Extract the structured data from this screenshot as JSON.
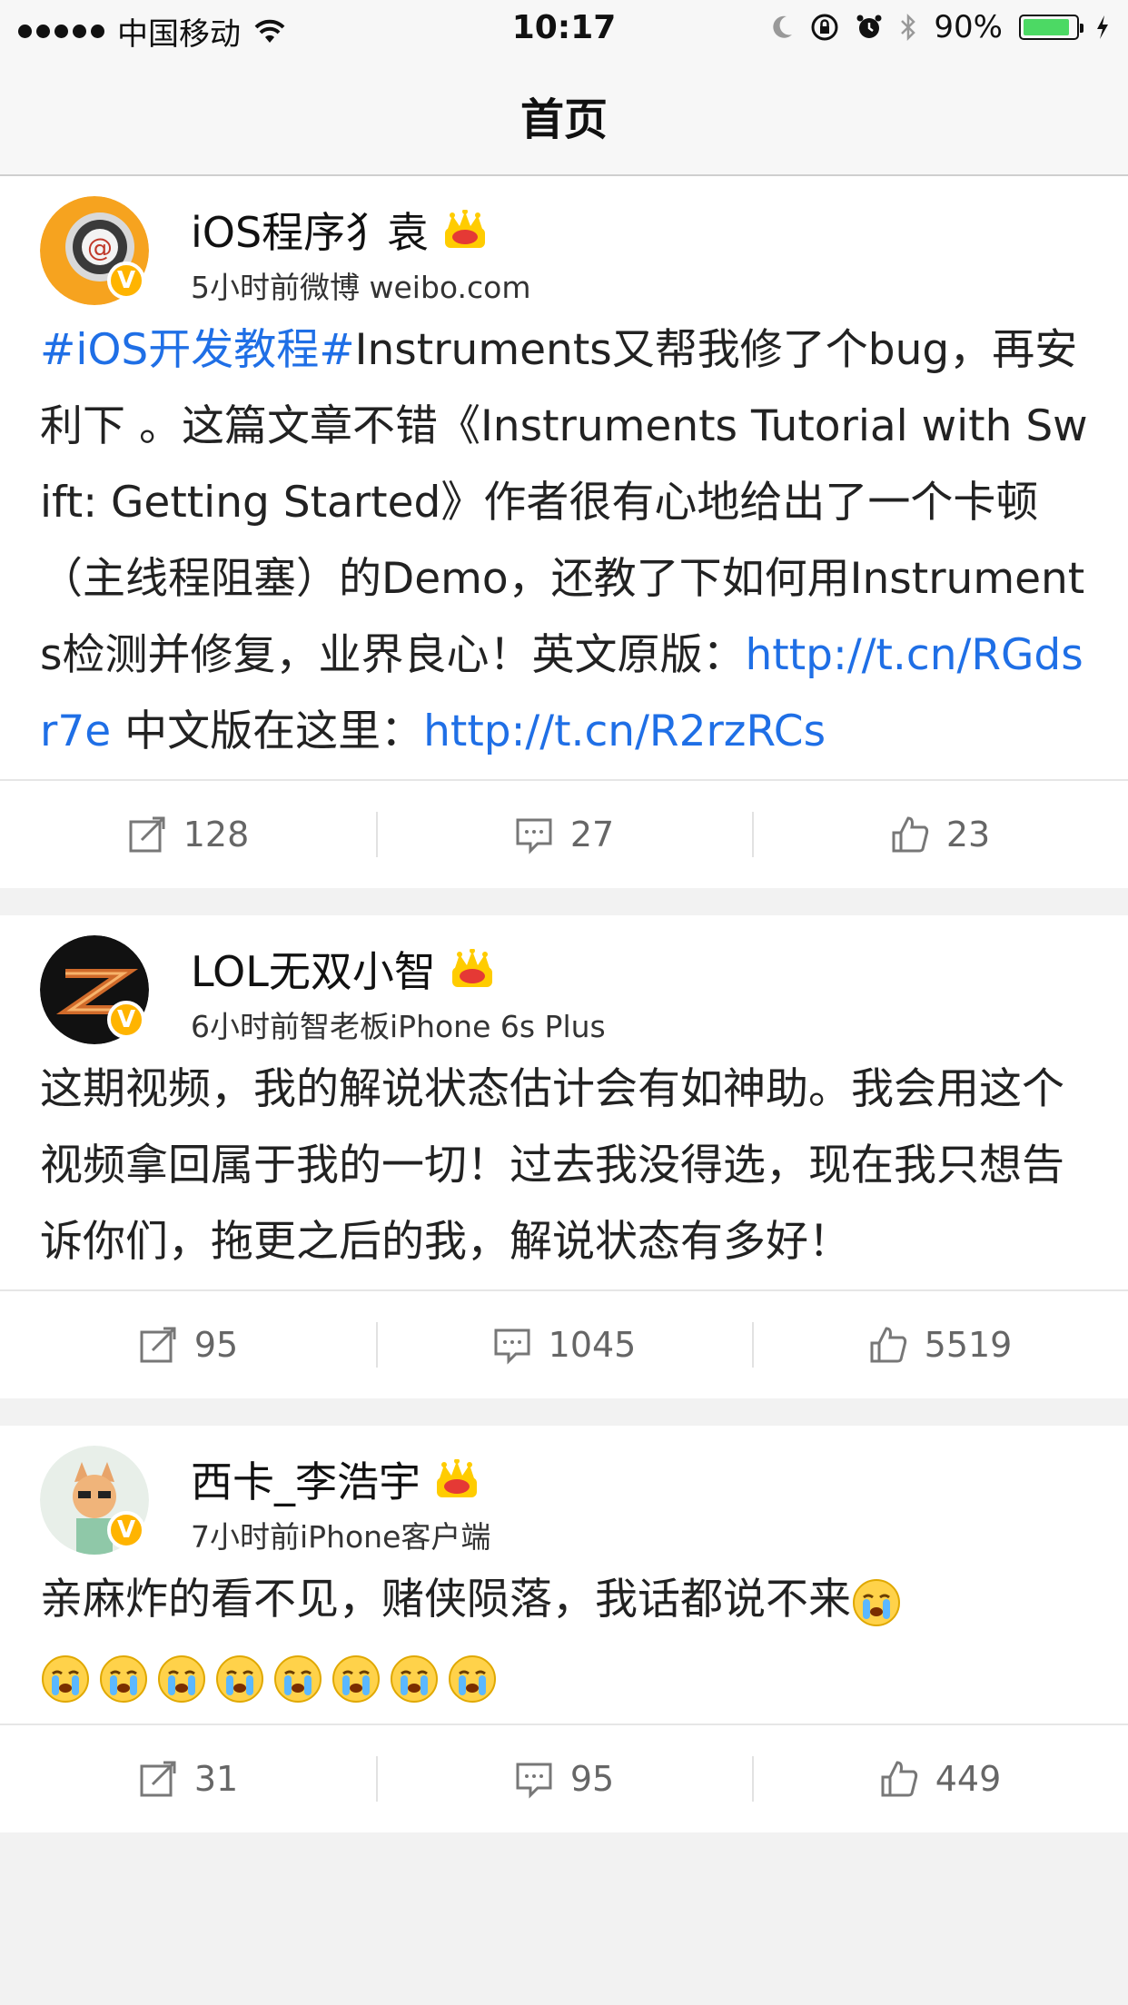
{
  "status_bar": {
    "carrier": "中国移动",
    "time": "10:17",
    "battery": "90%",
    "battery_level": 0.9
  },
  "nav": {
    "title": "首页"
  },
  "posts": [
    {
      "user": "iOS程序犭袁",
      "meta": "5小时前微博 weibo.com",
      "hashtag": "#iOS开发教程#",
      "text1": "Instruments又帮我修了个bug，再安利下 。这篇文章不错《Instruments Tutorial with Swift: Getting Started》作者很有心地给出了一个卡顿（主线程阻塞）的Demo，还教了下如何用Instruments检测并修复，业界良心！英文原版：",
      "link1": "http://t.cn/RGdsr7e",
      "text2": " 中文版在这里：",
      "link2": "http://t.cn/R2rzRCs",
      "repost": "128",
      "comment": "27",
      "like": "23"
    },
    {
      "user": "LOL无双小智",
      "meta": "6小时前智老板iPhone 6s Plus",
      "text": "这期视频，我的解说状态估计会有如神助。我会用这个视频拿回属于我的一切！过去我没得选，现在我只想告诉你们，拖更之后的我，解说状态有多好！",
      "repost": "95",
      "comment": "1045",
      "like": "5519"
    },
    {
      "user": "西卡_李浩宇",
      "meta": "7小时前iPhone客户端",
      "text": "亲麻炸的看不见，赌侠陨落，我话都说不来",
      "repost": "31",
      "comment": "95",
      "like": "449"
    }
  ],
  "verified_mark": "V",
  "icons": {
    "repost": "repost-icon",
    "comment": "comment-icon",
    "like": "like-icon",
    "crown": "crown-icon",
    "emoji": "crying-emoji"
  },
  "colors": {
    "link": "#1f6fe6",
    "badge": "#ffb400",
    "battery": "#4cd964"
  }
}
